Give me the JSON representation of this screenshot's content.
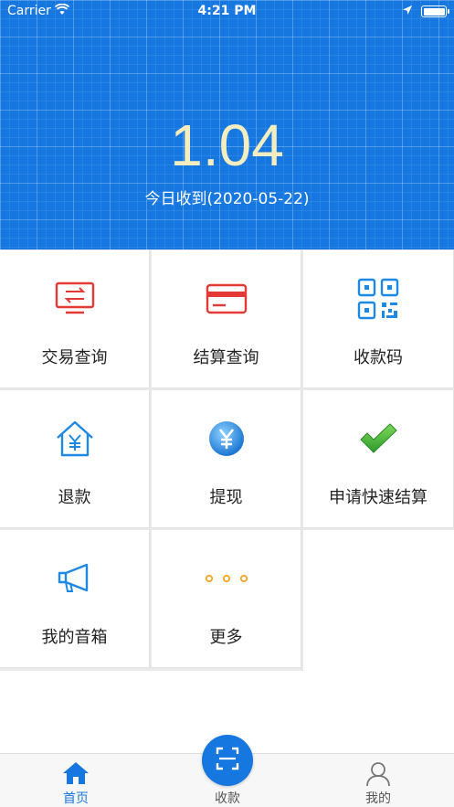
{
  "status_bar": {
    "carrier": "Carrier",
    "time": "4:21 PM"
  },
  "summary": {
    "amount": "1.04",
    "subtitle": "今日收到(2020-05-22)"
  },
  "grid": {
    "items": [
      {
        "label": "交易查询",
        "icon": "transaction-icon",
        "color": "#e53935"
      },
      {
        "label": "结算查询",
        "icon": "card-icon",
        "color": "#e53935"
      },
      {
        "label": "收款码",
        "icon": "qrcode-icon",
        "color": "#1e88e5"
      },
      {
        "label": "退款",
        "icon": "refund-house-icon",
        "color": "#1e88e5"
      },
      {
        "label": "提现",
        "icon": "yen-coin-icon",
        "color": "#1e88e5"
      },
      {
        "label": "申请快速结算",
        "icon": "checkmark-icon",
        "color": "#43a047"
      },
      {
        "label": "我的音箱",
        "icon": "megaphone-icon",
        "color": "#1e88e5"
      },
      {
        "label": "更多",
        "icon": "more-dots-icon",
        "color": "#f5a623"
      }
    ]
  },
  "tabbar": {
    "home": "首页",
    "collect": "收款",
    "mine": "我的",
    "active_color": "#1677e0"
  }
}
